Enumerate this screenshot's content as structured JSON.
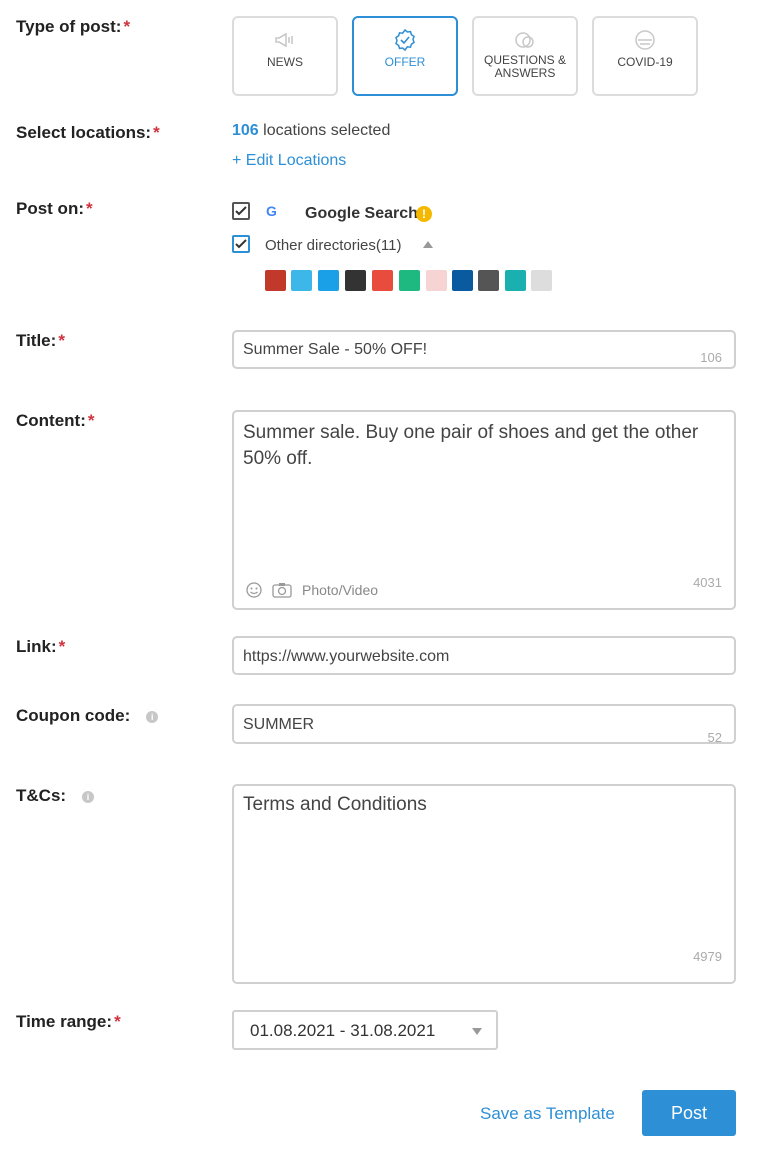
{
  "type_of_post": {
    "label": "Type of post:",
    "required": "*",
    "options": [
      {
        "label": "NEWS",
        "icon": "megaphone-icon",
        "active": false
      },
      {
        "label": "OFFER",
        "icon": "badge-check-icon",
        "active": true
      },
      {
        "label": "QUESTIONS & ANSWERS",
        "icon": "chat-bubbles-icon",
        "active": false
      },
      {
        "label": "COVID-19",
        "icon": "face-mask-icon",
        "active": false
      }
    ]
  },
  "locations": {
    "label": "Select locations:",
    "required": "*",
    "count": "106",
    "suffix": " locations selected",
    "edit_link": "+ Edit Locations"
  },
  "post_on": {
    "label": "Post on:",
    "required": "*",
    "google_letter": "G",
    "google_label": "Google Search",
    "warning_glyph": "!",
    "other_label": "Other directories(11)",
    "directories": [
      "#c0392b",
      "#3db7e8",
      "#1aa0e6",
      "#333333",
      "#e74c3c",
      "#1eb980",
      "#f7d4d4",
      "#0a5aa0",
      "#555555",
      "#1ab0b0",
      "#dddddd"
    ]
  },
  "title_field": {
    "label": "Title:",
    "required": "*",
    "value": "Summer Sale - 50% OFF!",
    "count": "106"
  },
  "content_field": {
    "label": "Content:",
    "required": "*",
    "value": "Summer sale. Buy one pair of shoes and get the other 50% off.",
    "media_label": "Photo/Video",
    "count": "4031"
  },
  "link_field": {
    "label": "Link:",
    "required": "*",
    "value": "https://www.yourwebsite.com"
  },
  "coupon_field": {
    "label": "Coupon code:",
    "value": "SUMMER",
    "count": "52",
    "info": "i"
  },
  "tcs_field": {
    "label": "T&Cs:",
    "value": "Terms and Conditions",
    "count": "4979",
    "info": "i"
  },
  "time_range": {
    "label": "Time range:",
    "required": "*",
    "value": "01.08.2021 - 31.08.2021"
  },
  "actions": {
    "save_template": "Save as Template",
    "post": "Post"
  },
  "colors": {
    "accent": "#2d8fd5",
    "required": "#d0313c",
    "warning": "#f5b800"
  }
}
